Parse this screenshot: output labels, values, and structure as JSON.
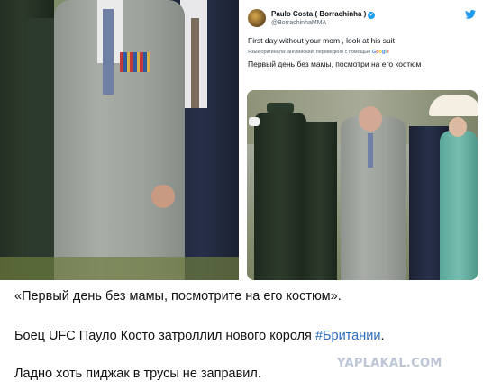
{
  "tweet": {
    "author_name": "Paulo Costa ( Borrachinha )",
    "handle": "@BorrachinhaMMA",
    "text": "First day without your mom , look at his suit",
    "translation_note": "Язык оригинала: английский, переведено с помощью",
    "translation_service": "Google",
    "translated_text": "Первый день без мамы, посмотри на его костюм"
  },
  "post": {
    "caption_quote": "«Первый день без мамы, посмотрите на его костюм».",
    "caption_line2_text": "Боец UFC Пауло Косто затроллил нового короля ",
    "caption_line2_hashtag": "#Британии",
    "caption_line2_end": ".",
    "caption_line3": "Ладно хоть пиджак в трусы не заправил."
  },
  "watermark": "YAPLAKAL.COM",
  "icons": {
    "verified": "verified-badge-icon",
    "twitter": "twitter-bird-icon"
  },
  "colors": {
    "twitter_blue": "#1d9bf0",
    "hashtag": "#2a6bbf",
    "watermark": "#bcc6d6"
  }
}
